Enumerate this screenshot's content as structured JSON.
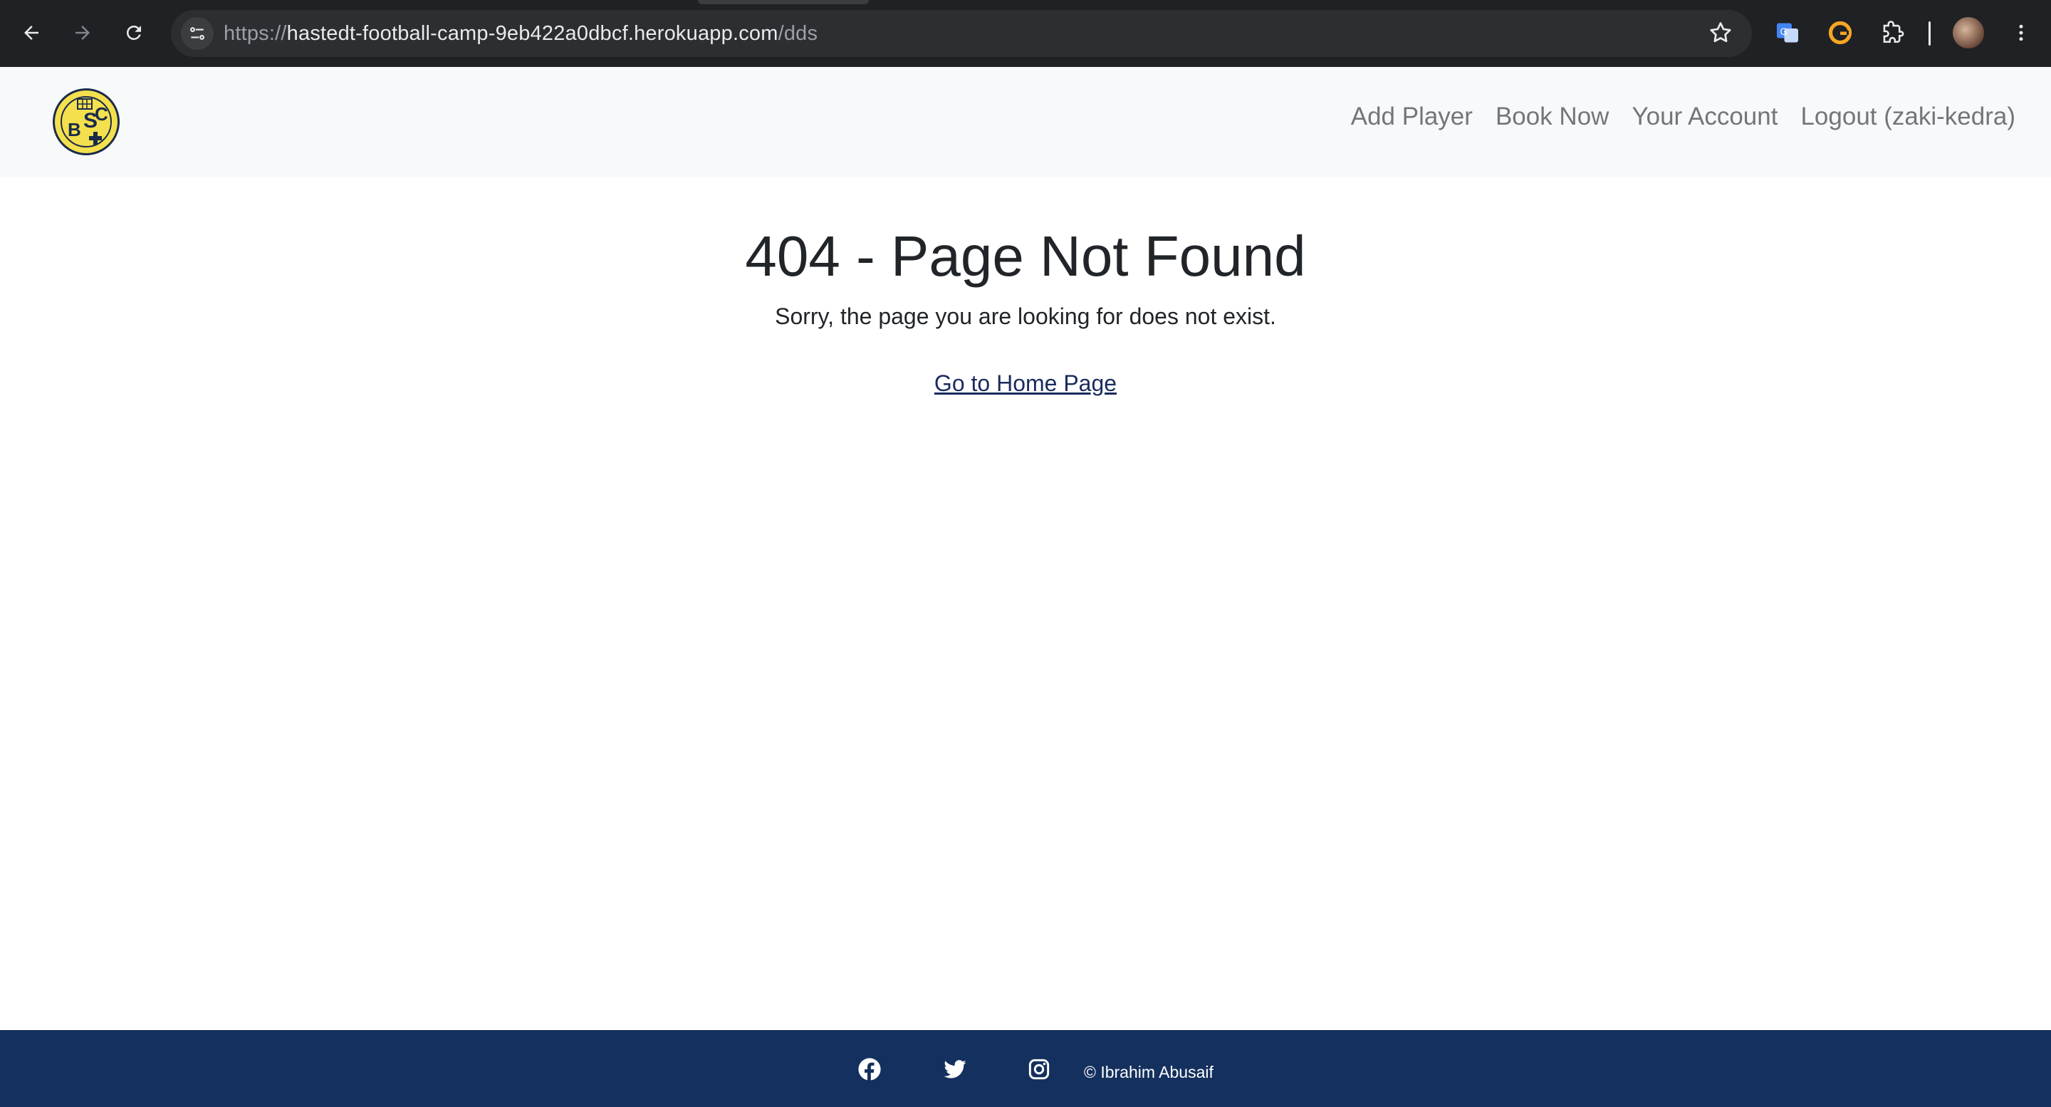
{
  "browser": {
    "url_scheme": "https://",
    "url_host": "hastedt-football-camp-9eb422a0dbcf.herokuapp.com",
    "url_path": "/dds",
    "icons": [
      "back-icon",
      "forward-icon",
      "reload-icon",
      "site-settings-icon",
      "bookmark-star-icon",
      "translate-extension-icon",
      "grammarly-extension-icon",
      "extensions-puzzle-icon",
      "profile-avatar",
      "menu-dots-icon"
    ]
  },
  "navbar": {
    "logo_letters": [
      "B",
      "S",
      "C"
    ],
    "links": [
      {
        "label": "Add Player"
      },
      {
        "label": "Book Now"
      },
      {
        "label": "Your Account"
      },
      {
        "label": "Logout (zaki-kedra)"
      }
    ]
  },
  "main": {
    "title": "404 - Page Not Found",
    "message": "Sorry, the page you are looking for does not exist.",
    "home_link": "Go to Home Page"
  },
  "footer": {
    "social_icons": [
      "facebook-icon",
      "twitter-icon",
      "instagram-icon"
    ],
    "copyright": "© Ibrahim Abusaif"
  },
  "colors": {
    "browser_bg": "#202124",
    "navbar_bg": "#f8f9fa",
    "footer_bg": "#14305e",
    "logo_yellow": "#f4e04d",
    "link_color": "#1a2b5e"
  }
}
